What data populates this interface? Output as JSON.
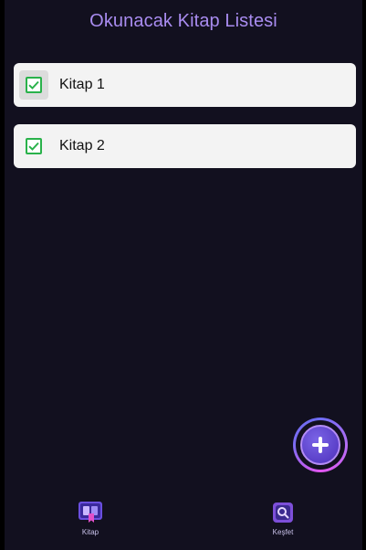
{
  "header": {
    "title": "Okunacak Kitap Listesi"
  },
  "books": [
    {
      "title": "Kitap 1",
      "checked": true
    },
    {
      "title": "Kitap 2",
      "checked": true
    }
  ],
  "fab": {
    "icon": "plus-icon"
  },
  "bottom_nav": {
    "items": [
      {
        "label": "Kitap",
        "icon": "book-icon",
        "active": true
      },
      {
        "label": "Keşfet",
        "icon": "search-icon",
        "active": false
      }
    ]
  },
  "colors": {
    "background": "#12101f",
    "accent": "#a98cf0",
    "card": "#f3f3f3",
    "check": "#2ab24b",
    "fab_gradient_start": "#6d6cf3",
    "fab_gradient_end": "#e356f0"
  }
}
